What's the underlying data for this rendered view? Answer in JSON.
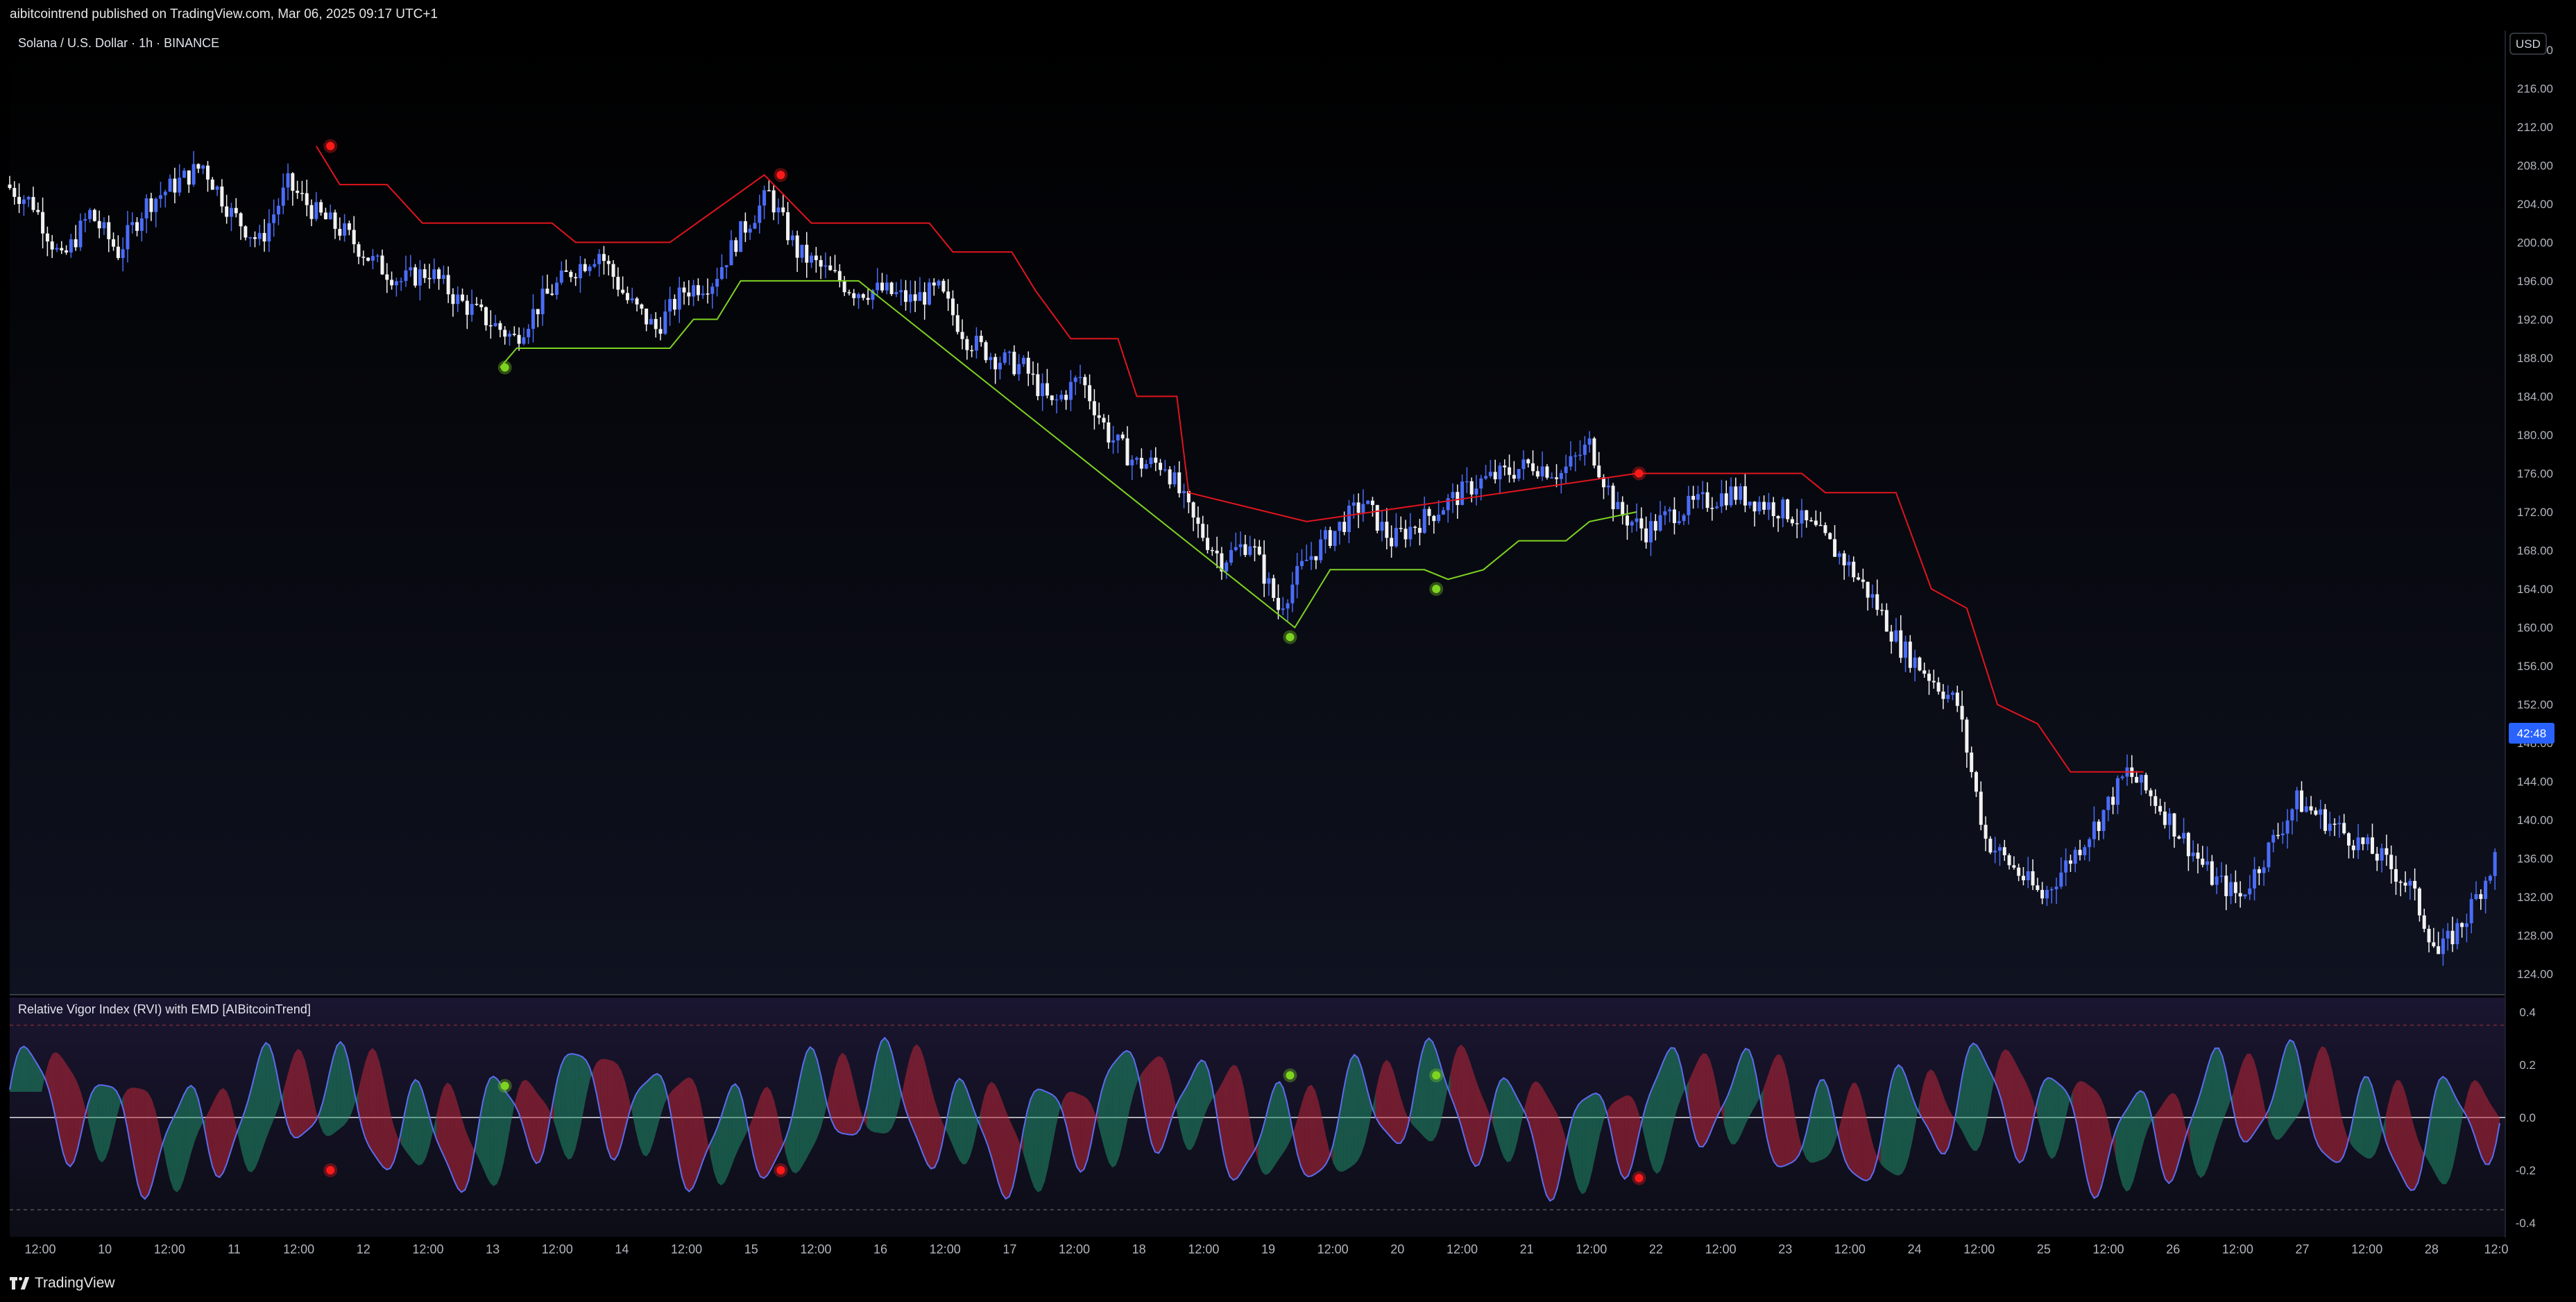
{
  "header": {
    "attribution": "aibitcointrend published on TradingView.com, Mar 06, 2025 09:17 UTC+1"
  },
  "footer": {
    "brand": "TradingView"
  },
  "chart_data": [
    {
      "type": "candlestick",
      "title": "Solana / U.S. Dollar · 1h · BINANCE",
      "currency_button": "USD",
      "current_price_label": "42:48",
      "ylim": [
        122,
        222
      ],
      "y_ticks": [
        "220.00",
        "216.00",
        "212.00",
        "208.00",
        "204.00",
        "200.00",
        "196.00",
        "192.00",
        "188.00",
        "184.00",
        "180.00",
        "176.00",
        "172.00",
        "168.00",
        "164.00",
        "160.00",
        "156.00",
        "152.00",
        "148.00",
        "144.00",
        "140.00",
        "136.00",
        "132.00",
        "128.00",
        "124.00"
      ],
      "x_ticks": [
        "12:00",
        "10",
        "12:00",
        "11",
        "12:00",
        "12",
        "12:00",
        "13",
        "12:00",
        "14",
        "12:00",
        "15",
        "12:00",
        "16",
        "12:00",
        "17",
        "12:00",
        "18",
        "12:00",
        "19",
        "12:00",
        "20",
        "12:00",
        "21",
        "12:00",
        "22",
        "12:00",
        "23",
        "12:00",
        "24",
        "12:00",
        "25",
        "12:00",
        "26",
        "12:00",
        "27",
        "12:00",
        "28",
        "12:0"
      ],
      "price_path": [
        [
          0,
          206
        ],
        [
          12,
          204
        ],
        [
          24,
          198
        ],
        [
          36,
          203
        ],
        [
          48,
          199
        ],
        [
          60,
          204
        ],
        [
          72,
          206
        ],
        [
          84,
          208
        ],
        [
          96,
          203
        ],
        [
          108,
          200
        ],
        [
          120,
          206
        ],
        [
          132,
          203
        ],
        [
          144,
          201
        ],
        [
          156,
          198
        ],
        [
          168,
          196
        ],
        [
          180,
          197
        ],
        [
          192,
          194
        ],
        [
          204,
          192
        ],
        [
          216,
          190
        ],
        [
          228,
          194
        ],
        [
          240,
          197
        ],
        [
          252,
          199
        ],
        [
          264,
          194
        ],
        [
          276,
          191
        ],
        [
          288,
          195
        ],
        [
          300,
          196
        ],
        [
          312,
          201
        ],
        [
          324,
          205
        ],
        [
          336,
          199
        ],
        [
          348,
          197
        ],
        [
          360,
          195
        ],
        [
          372,
          195
        ],
        [
          384,
          194
        ],
        [
          396,
          195
        ],
        [
          408,
          190
        ],
        [
          420,
          188
        ],
        [
          432,
          187
        ],
        [
          444,
          183
        ],
        [
          456,
          186
        ],
        [
          468,
          180
        ],
        [
          480,
          177
        ],
        [
          492,
          177
        ],
        [
          504,
          171
        ],
        [
          516,
          167
        ],
        [
          528,
          169
        ],
        [
          540,
          162
        ],
        [
          552,
          167
        ],
        [
          564,
          170
        ],
        [
          576,
          173
        ],
        [
          588,
          169
        ],
        [
          600,
          171
        ],
        [
          612,
          173
        ],
        [
          624,
          175
        ],
        [
          636,
          176
        ],
        [
          648,
          177
        ],
        [
          660,
          176
        ],
        [
          672,
          179
        ],
        [
          684,
          172
        ],
        [
          696,
          170
        ],
        [
          708,
          172
        ],
        [
          720,
          173
        ],
        [
          732,
          174
        ],
        [
          744,
          173
        ],
        [
          756,
          172
        ],
        [
          768,
          170
        ],
        [
          780,
          167
        ],
        [
          792,
          163
        ],
        [
          804,
          158
        ],
        [
          816,
          155
        ],
        [
          828,
          152
        ],
        [
          840,
          138
        ],
        [
          852,
          135
        ],
        [
          864,
          132
        ],
        [
          876,
          136
        ],
        [
          888,
          140
        ],
        [
          900,
          145
        ],
        [
          912,
          142
        ],
        [
          924,
          138
        ],
        [
          936,
          134
        ],
        [
          948,
          132
        ],
        [
          960,
          137
        ],
        [
          972,
          142
        ],
        [
          984,
          140
        ],
        [
          996,
          138
        ],
        [
          1008,
          136
        ],
        [
          1020,
          133
        ],
        [
          1032,
          126
        ],
        [
          1044,
          130
        ],
        [
          1056,
          136
        ]
      ],
      "x_range": [
        0,
        1056
      ],
      "resistance_line": [
        [
          0,
          null
        ],
        [
          130,
          210
        ],
        [
          140,
          206
        ],
        [
          160,
          206
        ],
        [
          175,
          202
        ],
        [
          230,
          202
        ],
        [
          240,
          200
        ],
        [
          280,
          200
        ],
        [
          320,
          207
        ],
        [
          340,
          202
        ],
        [
          390,
          202
        ],
        [
          400,
          199
        ],
        [
          425,
          199
        ],
        [
          435,
          195
        ],
        [
          450,
          190
        ],
        [
          470,
          190
        ],
        [
          478,
          184
        ],
        [
          495,
          184
        ],
        [
          500,
          174
        ],
        [
          550,
          171
        ],
        [
          690,
          176
        ],
        [
          760,
          176
        ],
        [
          770,
          174
        ],
        [
          800,
          174
        ],
        [
          806,
          170
        ],
        [
          815,
          164
        ],
        [
          830,
          162
        ],
        [
          843,
          152
        ],
        [
          860,
          150
        ],
        [
          874,
          145
        ],
        [
          905,
          145
        ]
      ],
      "support_line": [
        [
          208,
          187
        ],
        [
          215,
          189
        ],
        [
          280,
          189
        ],
        [
          290,
          192
        ],
        [
          300,
          192
        ],
        [
          310,
          196
        ],
        [
          360,
          196
        ],
        [
          545,
          160
        ],
        [
          560,
          166
        ],
        [
          600,
          166
        ],
        [
          610,
          165
        ],
        [
          625,
          166
        ],
        [
          640,
          169
        ],
        [
          660,
          169
        ],
        [
          670,
          171
        ],
        [
          690,
          172
        ]
      ],
      "resistance_signals": [
        [
          136,
          210
        ],
        [
          327,
          207
        ],
        [
          691,
          176
        ]
      ],
      "support_signals": [
        [
          210,
          187
        ],
        [
          543,
          159
        ],
        [
          605,
          164
        ]
      ]
    },
    {
      "type": "area",
      "title": "Relative Vigor Index (RVI) with EMD [AIBitcoinTrend]",
      "ylim": [
        -0.45,
        0.45
      ],
      "y_ticks": [
        "0.4",
        "0.2",
        "0.0",
        "-0.2",
        "-0.4"
      ],
      "upper_band": 0.35,
      "lower_band": -0.35,
      "bearish_signals": [
        [
          136,
          -0.2
        ],
        [
          327,
          -0.2
        ],
        [
          691,
          -0.23
        ]
      ],
      "bullish_signals": [
        [
          210,
          0.12
        ],
        [
          543,
          0.16
        ],
        [
          605,
          0.16
        ]
      ]
    }
  ]
}
